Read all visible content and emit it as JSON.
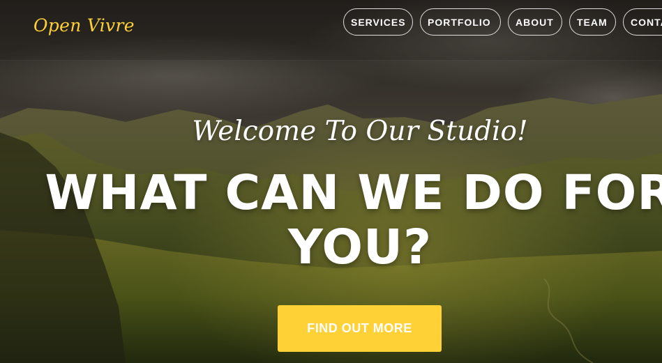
{
  "brand": {
    "name": "Open Vivre",
    "color": "#fed136"
  },
  "nav": {
    "items": [
      {
        "label": "SERVICES"
      },
      {
        "label": "PORTFOLIO"
      },
      {
        "label": "ABOUT"
      },
      {
        "label": "TEAM"
      },
      {
        "label": "CONTACT"
      }
    ]
  },
  "hero": {
    "lead": "Welcome To Our Studio!",
    "heading": "WHAT CAN WE DO FOR YOU?",
    "cta_label": "FIND OUT MORE",
    "background": "mountain-landscape-photo"
  },
  "colors": {
    "accent": "#fed136",
    "text": "#ffffff"
  }
}
